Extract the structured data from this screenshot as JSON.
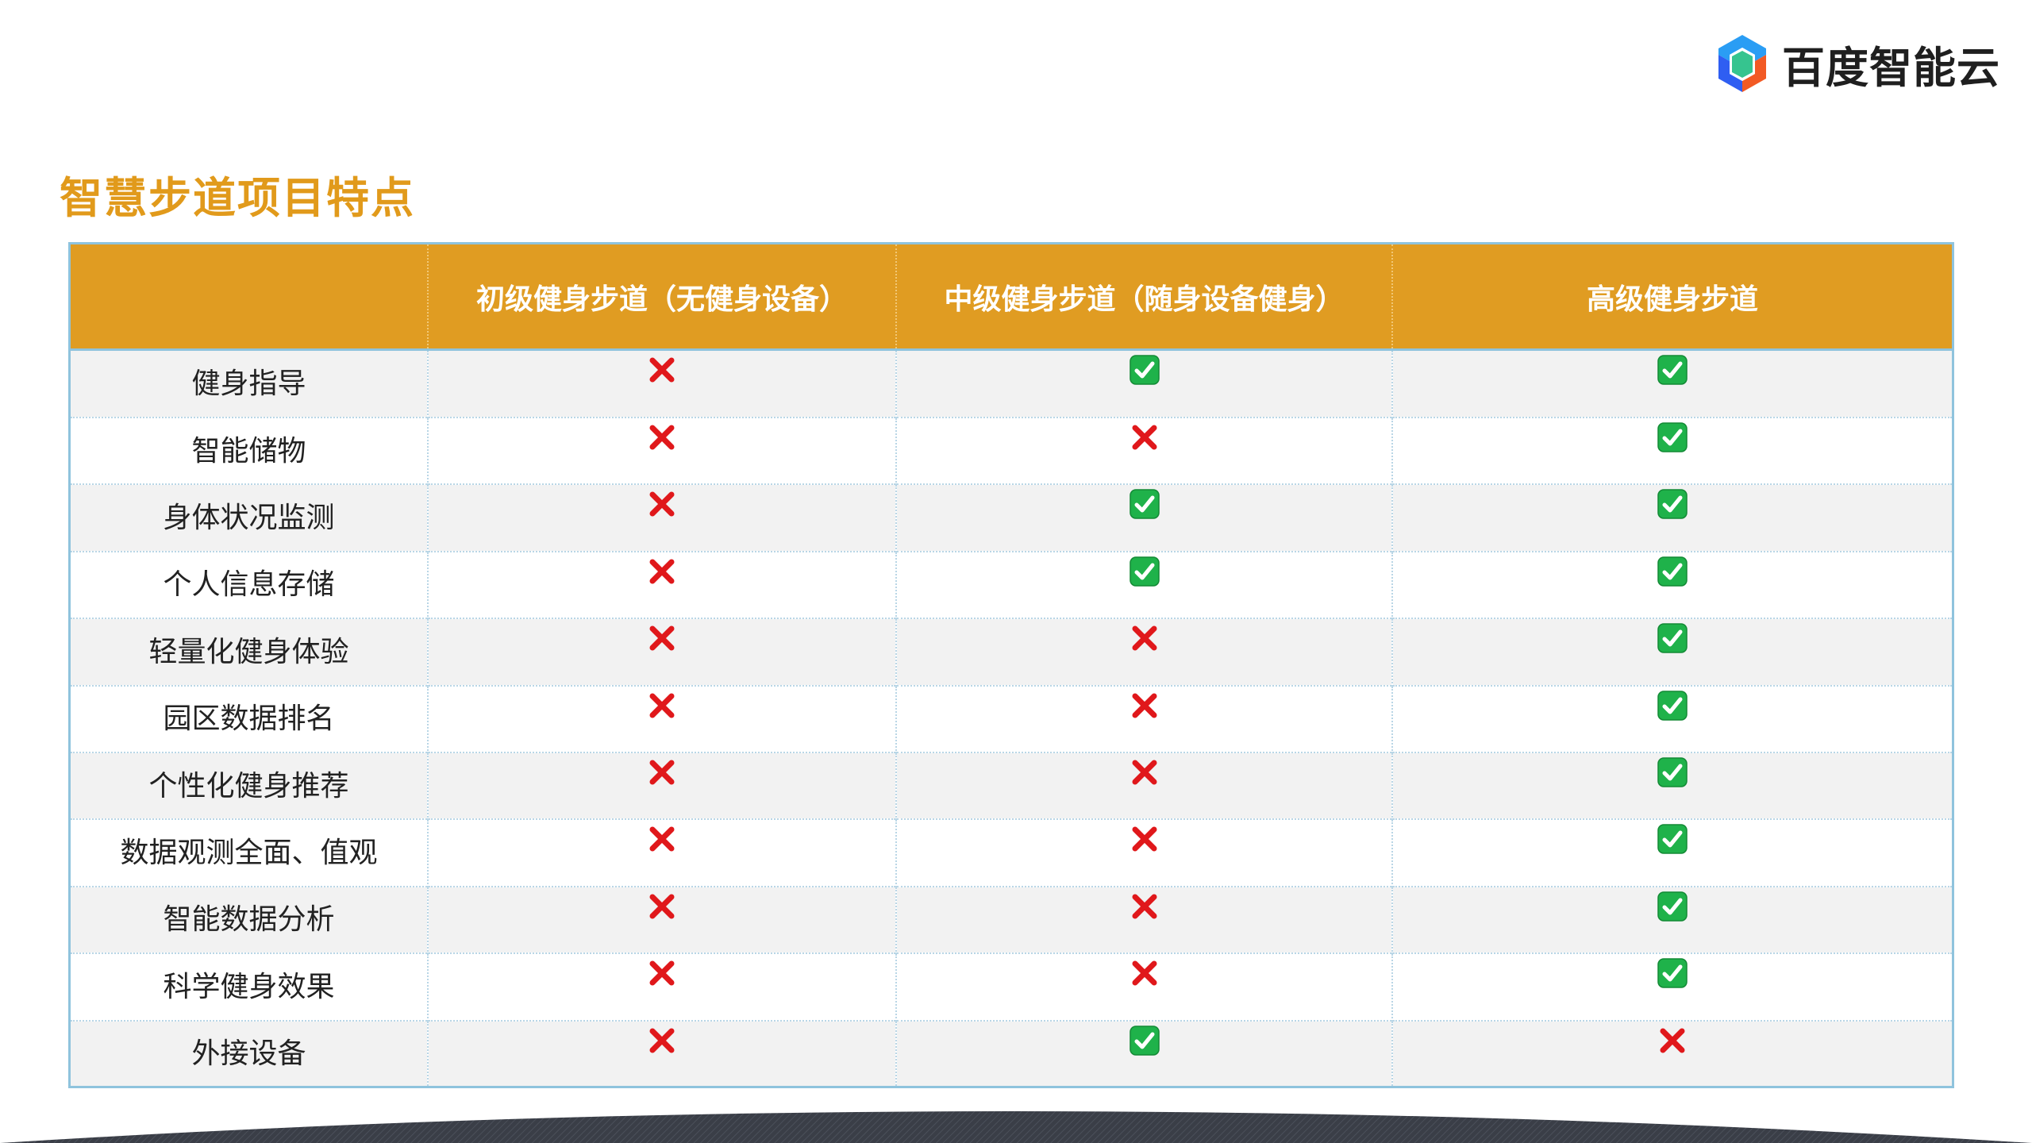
{
  "logo": {
    "text": "百度智能云",
    "icon": "baidu-cloud-hexagon-icon"
  },
  "title": "智慧步道项目特点",
  "table": {
    "headers": [
      "",
      "初级健身步道（无健身设备）",
      "中级健身步道（随身设备健身）",
      "高级健身步道"
    ],
    "rows": [
      {
        "feature": "健身指导",
        "values": [
          false,
          true,
          true
        ]
      },
      {
        "feature": "智能储物",
        "values": [
          false,
          false,
          true
        ]
      },
      {
        "feature": "身体状况监测",
        "values": [
          false,
          true,
          true
        ]
      },
      {
        "feature": "个人信息存储",
        "values": [
          false,
          true,
          true
        ]
      },
      {
        "feature": "轻量化健身体验",
        "values": [
          false,
          false,
          true
        ]
      },
      {
        "feature": "园区数据排名",
        "values": [
          false,
          false,
          true
        ]
      },
      {
        "feature": "个性化健身推荐",
        "values": [
          false,
          false,
          true
        ]
      },
      {
        "feature": "数据观测全面、值观",
        "values": [
          false,
          false,
          true
        ]
      },
      {
        "feature": "智能数据分析",
        "values": [
          false,
          false,
          true
        ]
      },
      {
        "feature": "科学健身效果",
        "values": [
          false,
          false,
          true
        ]
      },
      {
        "feature": "外接设备",
        "values": [
          false,
          true,
          false
        ]
      }
    ]
  },
  "colors": {
    "title": "#e19a1b",
    "header_bg": "#e09c22",
    "border": "#8fc3dd",
    "check_green": "#1fb24a",
    "cross_red": "#e0181b"
  },
  "icons": {
    "yes": "check-mark-button-icon",
    "no": "cross-mark-icon"
  }
}
